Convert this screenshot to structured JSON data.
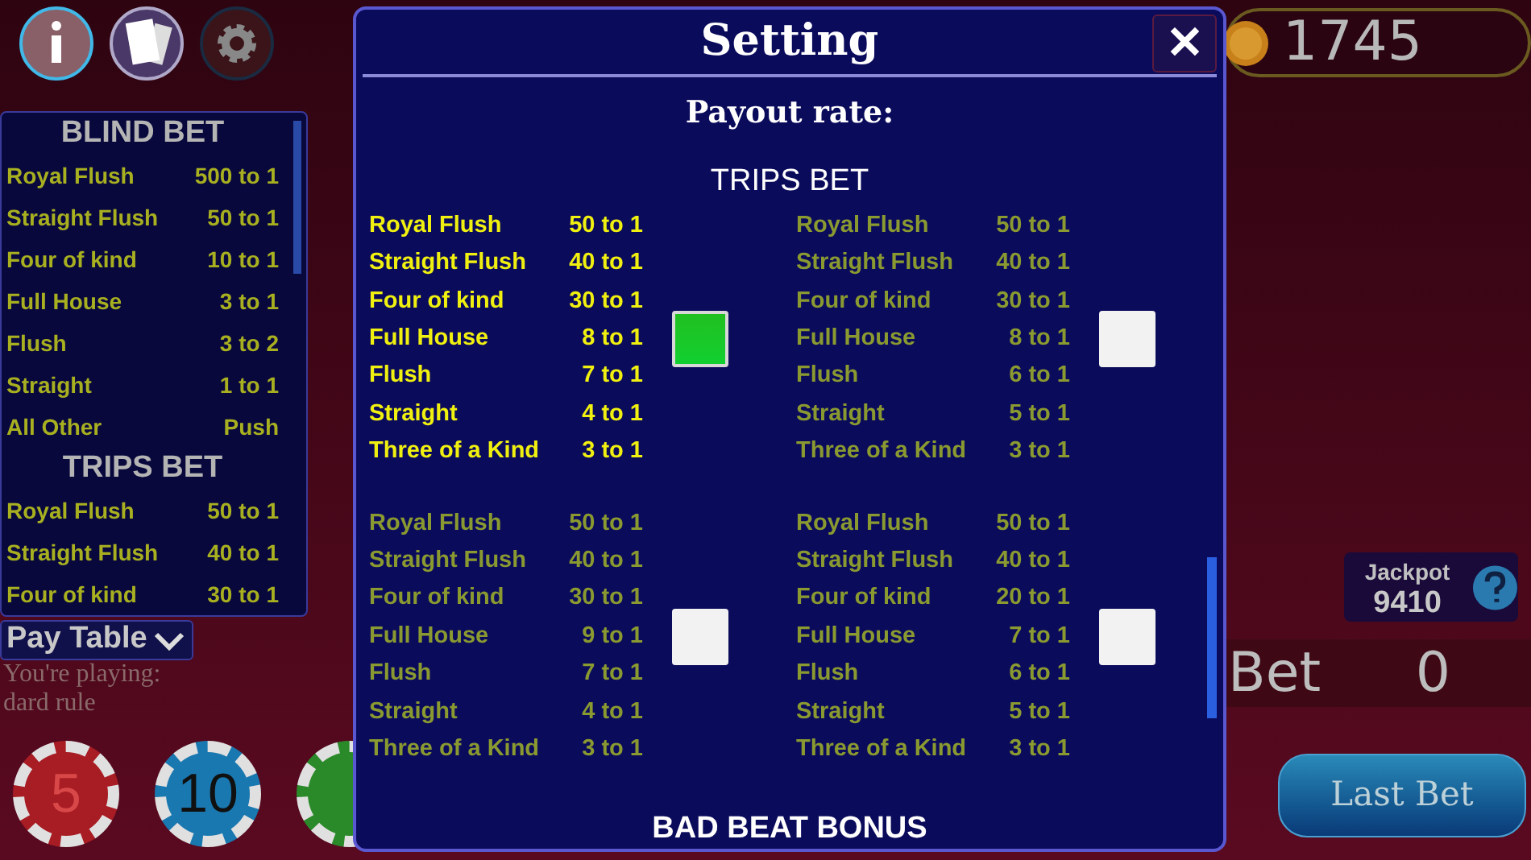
{
  "top_buttons": [
    {
      "kind": "info"
    },
    {
      "kind": "help"
    },
    {
      "kind": "settings"
    }
  ],
  "balance": "1745",
  "pay_table": {
    "sections": [
      {
        "title": "BLIND BET",
        "rows": [
          {
            "hand": "Royal Flush",
            "payout": "500 to 1"
          },
          {
            "hand": "Straight Flush",
            "payout": "50 to 1"
          },
          {
            "hand": "Four of kind",
            "payout": "10 to 1"
          },
          {
            "hand": "Full House",
            "payout": "3 to 1"
          },
          {
            "hand": "Flush",
            "payout": "3 to 2"
          },
          {
            "hand": "Straight",
            "payout": "1 to 1"
          },
          {
            "hand": "All Other",
            "payout": "Push"
          }
        ]
      },
      {
        "title": "TRIPS BET",
        "rows": [
          {
            "hand": "Royal Flush",
            "payout": "50 to 1"
          },
          {
            "hand": "Straight Flush",
            "payout": "40 to 1"
          },
          {
            "hand": "Four of kind",
            "payout": "30 to 1"
          }
        ]
      }
    ]
  },
  "pay_table_toggle": "Pay Table",
  "playing_note": [
    "You're playing:",
    "dard rule"
  ],
  "chips": [
    "5",
    "10"
  ],
  "jackpot": {
    "label": "Jackpot",
    "value": "9410"
  },
  "bet": {
    "label": "Bet",
    "value": "0"
  },
  "last_bet_button": "Last Bet",
  "dialog": {
    "title": "Setting",
    "close": "✕",
    "subtitle": "Payout rate:",
    "section": "TRIPS BET",
    "options": [
      {
        "selected": true,
        "rows": [
          {
            "hand": "Royal Flush",
            "payout": "50 to 1"
          },
          {
            "hand": "Straight Flush",
            "payout": "40 to 1"
          },
          {
            "hand": "Four of kind",
            "payout": "30 to 1"
          },
          {
            "hand": "Full House",
            "payout": "8 to 1"
          },
          {
            "hand": "Flush",
            "payout": "7 to 1"
          },
          {
            "hand": "Straight",
            "payout": "4 to 1"
          },
          {
            "hand": "Three of a Kind",
            "payout": "3 to 1"
          }
        ]
      },
      {
        "selected": false,
        "rows": [
          {
            "hand": "Royal Flush",
            "payout": "50 to 1"
          },
          {
            "hand": "Straight Flush",
            "payout": "40 to 1"
          },
          {
            "hand": "Four of kind",
            "payout": "30 to 1"
          },
          {
            "hand": "Full House",
            "payout": "8 to 1"
          },
          {
            "hand": "Flush",
            "payout": "6 to 1"
          },
          {
            "hand": "Straight",
            "payout": "5 to 1"
          },
          {
            "hand": "Three of a Kind",
            "payout": "3 to 1"
          }
        ]
      },
      {
        "selected": false,
        "rows": [
          {
            "hand": "Royal Flush",
            "payout": "50 to 1"
          },
          {
            "hand": "Straight Flush",
            "payout": "40 to 1"
          },
          {
            "hand": "Four of kind",
            "payout": "30 to 1"
          },
          {
            "hand": "Full House",
            "payout": "9 to 1"
          },
          {
            "hand": "Flush",
            "payout": "7 to 1"
          },
          {
            "hand": "Straight",
            "payout": "4 to 1"
          },
          {
            "hand": "Three of a Kind",
            "payout": "3 to 1"
          }
        ]
      },
      {
        "selected": false,
        "rows": [
          {
            "hand": "Royal Flush",
            "payout": "50 to 1"
          },
          {
            "hand": "Straight Flush",
            "payout": "40 to 1"
          },
          {
            "hand": "Four of kind",
            "payout": "20 to 1"
          },
          {
            "hand": "Full House",
            "payout": "7 to 1"
          },
          {
            "hand": "Flush",
            "payout": "6 to 1"
          },
          {
            "hand": "Straight",
            "payout": "5 to 1"
          },
          {
            "hand": "Three of a Kind",
            "payout": "3 to 1"
          }
        ]
      }
    ],
    "next_section": "BAD BEAT BONUS"
  }
}
